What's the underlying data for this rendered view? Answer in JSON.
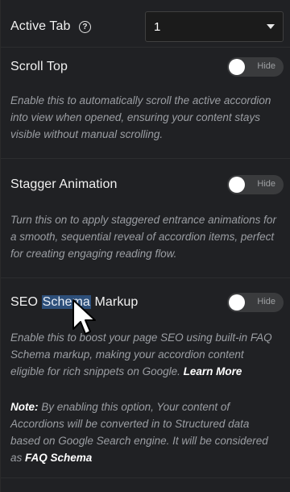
{
  "active_tab": {
    "label": "Active Tab",
    "help_glyph": "?",
    "selected_value": "1"
  },
  "scroll_top": {
    "label": "Scroll Top",
    "toggle_text": "Hide",
    "description": "Enable this to automatically scroll the active accordion into view when opened, ensuring your content stays visible without manual scrolling."
  },
  "stagger_animation": {
    "label": "Stagger Animation",
    "toggle_text": "Hide",
    "description": "Turn this on to apply staggered entrance animations for a smooth, sequential reveal of accordion items, perfect for creating engaging reading flow."
  },
  "seo_schema": {
    "label_before": "SEO ",
    "label_highlight": "Schema",
    "label_after": " Markup",
    "toggle_text": "Hide",
    "description_part1": "Enable this to boost your page SEO using built-in FAQ Schema markup, making your accordion content eligible for rich snippets on Google.",
    "learn_more": "Learn More",
    "note_label": "Note:",
    "note_text": "By enabling this option, Your content of Accordions will be converted in to Structured data based on Google Search engine. It will be considered as",
    "note_link": "FAQ Schema"
  },
  "colors": {
    "background": "#202124",
    "toggle_track": "#3a3b3d",
    "description_text": "#9b9ea3",
    "highlight": "#2d4f7a"
  },
  "icons": [
    "help-circle-icon",
    "chevron-down-icon",
    "mouse-pointer-icon"
  ]
}
